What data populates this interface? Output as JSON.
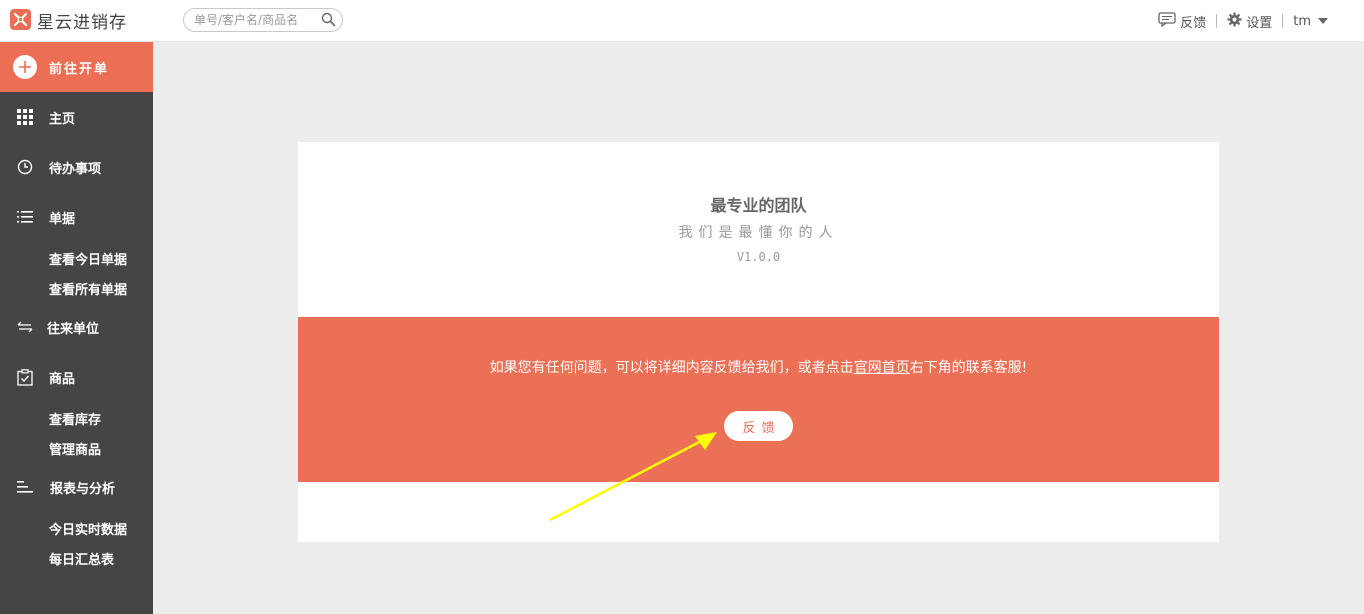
{
  "app": {
    "name": "星云进销存"
  },
  "search": {
    "placeholder": "单号/客户名/商品名",
    "value": ""
  },
  "topbar": {
    "feedback_label": "反馈",
    "settings_label": "设置",
    "user_label": "tm"
  },
  "sidebar": {
    "new_order_label": "前往开单",
    "items": [
      {
        "label": "主页",
        "icon": "grid-icon"
      },
      {
        "label": "待办事项",
        "icon": "clock-icon"
      },
      {
        "label": "单据",
        "icon": "list-icon",
        "children": [
          "查看今日单据",
          "查看所有单据"
        ]
      },
      {
        "label": "往来单位",
        "icon": "exchange-icon"
      },
      {
        "label": "商品",
        "icon": "clipboard-check-icon",
        "children": [
          "查看库存",
          "管理商品"
        ]
      },
      {
        "label": "报表与分析",
        "icon": "bars-icon",
        "children": [
          "今日实时数据",
          "每日汇总表"
        ]
      }
    ]
  },
  "card": {
    "title": "最专业的团队",
    "subtitle": "我们是最懂你的人",
    "version": "V1.0.0",
    "banner_text_before": "如果您有任何问题，可以将详细内容反馈给我们，或者点击",
    "banner_link": "官网首页",
    "banner_text_after": "右下角的联系客服!",
    "feedback_button": "反馈"
  },
  "colors": {
    "accent": "#ec6e55",
    "sidebar_bg": "#454545",
    "page_bg": "#ededed",
    "annotation_arrow": "#ffff00"
  }
}
